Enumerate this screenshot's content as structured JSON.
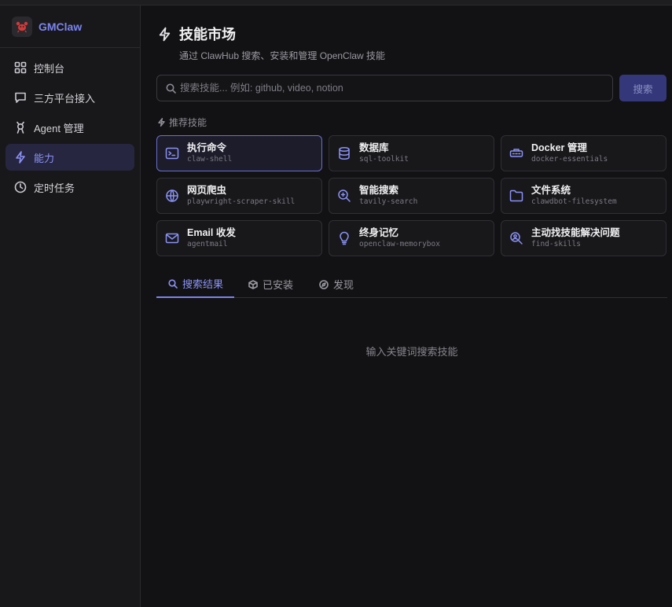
{
  "app": {
    "name": "GMClaw"
  },
  "sidebar": {
    "items": [
      {
        "label": "控制台",
        "icon": "grid-icon"
      },
      {
        "label": "三方平台接入",
        "icon": "chat-icon"
      },
      {
        "label": "Agent 管理",
        "icon": "agent-icon"
      },
      {
        "label": "能力",
        "icon": "bolt-icon",
        "active": true
      },
      {
        "label": "定时任务",
        "icon": "clock-icon"
      }
    ]
  },
  "header": {
    "title": "技能市场",
    "subtitle": "通过 ClawHub 搜索、安装和管理 OpenClaw 技能"
  },
  "search": {
    "placeholder": "搜索技能... 例如: github, video, notion",
    "value": "",
    "button_label": "搜索"
  },
  "recommended": {
    "label": "推荐技能",
    "skills": [
      {
        "name": "执行命令",
        "slug": "claw-shell",
        "icon": "terminal-icon"
      },
      {
        "name": "数据库",
        "slug": "sql-toolkit",
        "icon": "database-icon"
      },
      {
        "name": "Docker 管理",
        "slug": "docker-essentials",
        "icon": "container-icon"
      },
      {
        "name": "网页爬虫",
        "slug": "playwright-scraper-skill",
        "icon": "globe-icon"
      },
      {
        "name": "智能搜索",
        "slug": "tavily-search",
        "icon": "zoom-search-icon"
      },
      {
        "name": "文件系统",
        "slug": "clawdbot-filesystem",
        "icon": "folder-icon"
      },
      {
        "name": "Email 收发",
        "slug": "agentmail",
        "icon": "mail-icon"
      },
      {
        "name": "终身记忆",
        "slug": "openclaw-memorybox",
        "icon": "lightbulb-icon"
      },
      {
        "name": "主动找技能解决问题",
        "slug": "find-skills",
        "icon": "search-person-icon"
      }
    ]
  },
  "tabs": [
    {
      "label": "搜索结果",
      "icon": "search-icon",
      "active": true
    },
    {
      "label": "已安装",
      "icon": "package-icon"
    },
    {
      "label": "发现",
      "icon": "compass-icon"
    }
  ],
  "empty_state": {
    "text": "输入关键词搜索技能"
  },
  "colors": {
    "accent": "#7c84f0",
    "background": "#121214",
    "sidebar": "#18181b"
  }
}
